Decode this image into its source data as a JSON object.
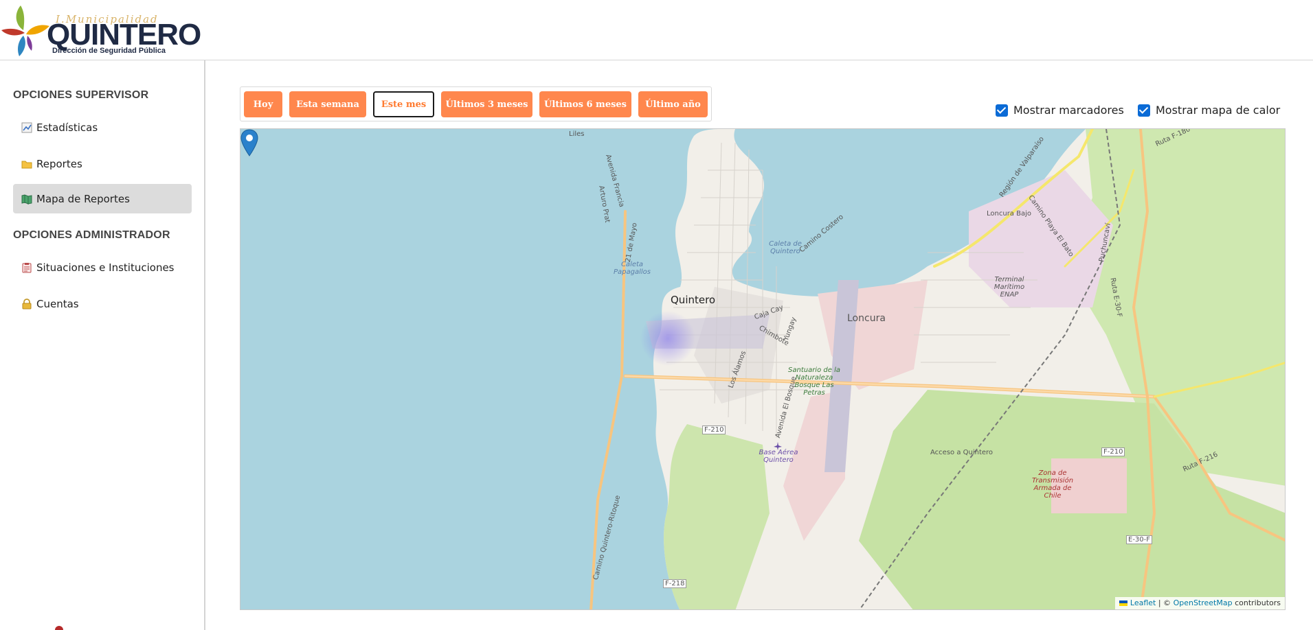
{
  "header": {
    "logo_small": "I.Municipalidad",
    "logo_main": "QUINTERO",
    "logo_sub": "Dirección de Seguridad Pública"
  },
  "sidebar": {
    "supervisor_heading": "OPCIONES SUPERVISOR",
    "admin_heading": "OPCIONES ADMINISTRADOR",
    "items": [
      {
        "label": "Estadísticas",
        "icon": "chart-icon",
        "active": false
      },
      {
        "label": "Reportes",
        "icon": "folder-icon",
        "active": false
      },
      {
        "label": "Mapa de Reportes",
        "icon": "map-icon",
        "active": true
      },
      {
        "label": "Situaciones e Instituciones",
        "icon": "clipboard-icon",
        "active": false
      },
      {
        "label": "Cuentas",
        "icon": "lock-icon",
        "active": false
      }
    ]
  },
  "filters": {
    "buttons": [
      "Hoy",
      "Esta semana",
      "Este mes",
      "Últimos 3 meses",
      "Últimos 6 meses",
      "Último año"
    ],
    "selected": "Este mes",
    "accent_color": "#ff874d"
  },
  "toggles": {
    "markers_label": "Mostrar marcadores",
    "markers_checked": true,
    "heatmap_label": "Mostrar mapa de calor",
    "heatmap_checked": true
  },
  "map": {
    "labels": {
      "city": "Quintero",
      "liles": "Liles",
      "caleta_quintero": "Caleta de Quintero",
      "caleta_papagallos": "Caleta Papagallos",
      "loncura": "Loncura",
      "loncura_bajo": "Loncura Bajo",
      "terminal": "Terminal Marítimo ENAP",
      "santuario": "Santuario de la Naturaleza Bosque Las Petras",
      "base_aerea": "Base Aérea Quintero",
      "zona": "Zona de Transmisión Armada de Chile",
      "acceso": "Acceso a Quintero",
      "f210_a": "F-210",
      "f210_b": "F-210",
      "f218": "F-218",
      "e30f": "E-30-F",
      "ruta_f180": "Ruta F-180",
      "ruta_f216": "Ruta F-216",
      "ruta_e30f": "Ruta E-30-F",
      "avenida_francia": "Avenida Francia",
      "arturo_prat": "Arturo Prat",
      "mayo": "21 de Mayo",
      "camino_costero": "Camino Costero",
      "camino_qr": "Camino Quintero-Ritoque",
      "los_alamos": "Los Álamos",
      "avenida_bosque": "Avenida El Bosque",
      "chimbote": "Chimbote",
      "yungay": "Yungay",
      "caja_cay": "Caja Cay",
      "camino_playa": "Camino Playa El Bato",
      "puchuncavi": "Puchuncaví",
      "region": "Región de Valparaíso"
    },
    "attribution_leaflet": "Leaflet",
    "attribution_sep": "| ©",
    "attribution_osm": "OpenStreetMap",
    "attribution_tail": "contributors",
    "marker_color": "#2a81cb"
  }
}
